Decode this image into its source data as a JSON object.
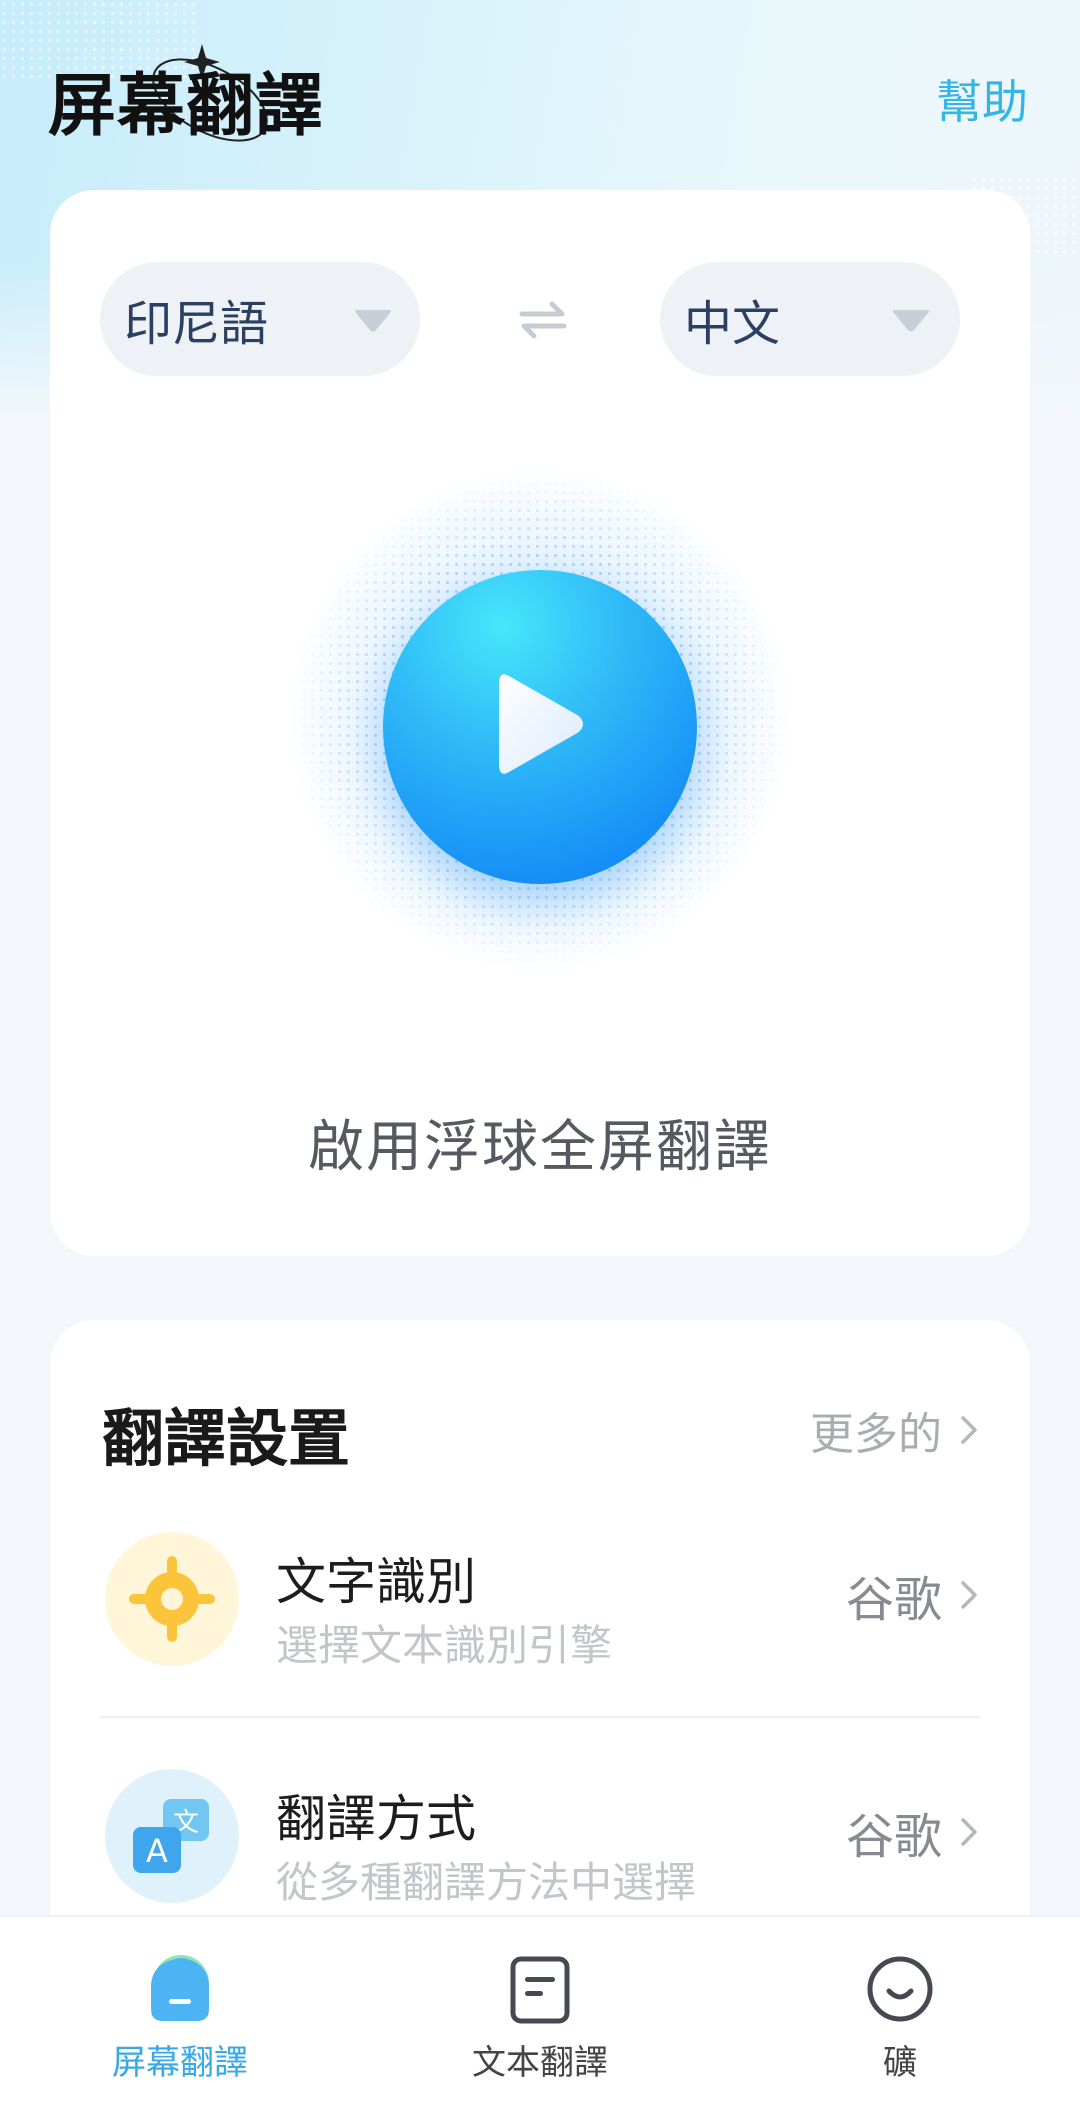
{
  "header": {
    "app_title": "屏幕翻譯",
    "help_label": "幫助"
  },
  "language_selector": {
    "source_language": "印尼語",
    "target_language": "中文"
  },
  "main": {
    "enable_label": "啟用浮球全屏翻譯"
  },
  "settings": {
    "title": "翻譯設置",
    "more_label": "更多的",
    "items": [
      {
        "title": "文字識別",
        "subtitle": "選擇文本識別引擎",
        "value": "谷歌",
        "icon": "crosshair-icon"
      },
      {
        "title": "翻譯方式",
        "subtitle": "從多種翻譯方法中選擇",
        "value": "谷歌",
        "icon": "translate-icon"
      }
    ]
  },
  "bottom_nav": {
    "items": [
      {
        "label": "屏幕翻譯",
        "icon": "screen-translate-icon",
        "active": true
      },
      {
        "label": "文本翻譯",
        "icon": "document-icon",
        "active": false
      },
      {
        "label": "礦",
        "icon": "smile-icon",
        "active": false
      }
    ]
  },
  "colors": {
    "accent": "#32b6e6",
    "play_button": "#1690f7",
    "active_nav": "#39a8e6"
  }
}
